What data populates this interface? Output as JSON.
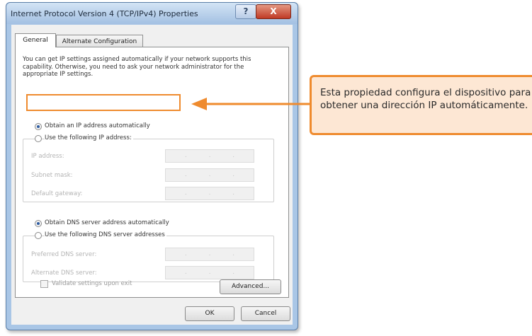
{
  "dialog": {
    "title": "Internet Protocol Version 4 (TCP/IPv4) Properties",
    "help_label": "?",
    "close_label": "X"
  },
  "tabs": [
    {
      "label": "General",
      "active": true
    },
    {
      "label": "Alternate Configuration",
      "active": false
    }
  ],
  "intro_text": "You can get IP settings assigned automatically if your network supports this capability. Otherwise, you need to ask your network administrator for the appropriate IP settings.",
  "ip": {
    "auto_label": "Obtain an IP address automatically",
    "auto_selected": true,
    "manual_label": "Use the following IP address:",
    "fields": [
      {
        "label": "IP address:",
        "value": ". . ."
      },
      {
        "label": "Subnet mask:",
        "value": ". . ."
      },
      {
        "label": "Default gateway:",
        "value": ". . ."
      }
    ]
  },
  "dns": {
    "auto_label": "Obtain DNS server address automatically",
    "auto_selected": true,
    "manual_label": "Use the following DNS server addresses",
    "fields": [
      {
        "label": "Preferred DNS server:",
        "value": ". . ."
      },
      {
        "label": "Alternate DNS server:",
        "value": ". . ."
      }
    ]
  },
  "validate_label": "Validate settings upon exit",
  "validate_checked": false,
  "buttons": {
    "advanced": "Advanced...",
    "ok": "OK",
    "cancel": "Cancel"
  },
  "callout": {
    "text": "Esta propiedad configura el dispositivo para obtener una dirección IP automáticamente."
  },
  "colors": {
    "accent_orange": "#ef8b2e",
    "callout_fill": "#fde7d4",
    "close_red": "#c03a25",
    "title_blue": "#a3c0e2"
  }
}
